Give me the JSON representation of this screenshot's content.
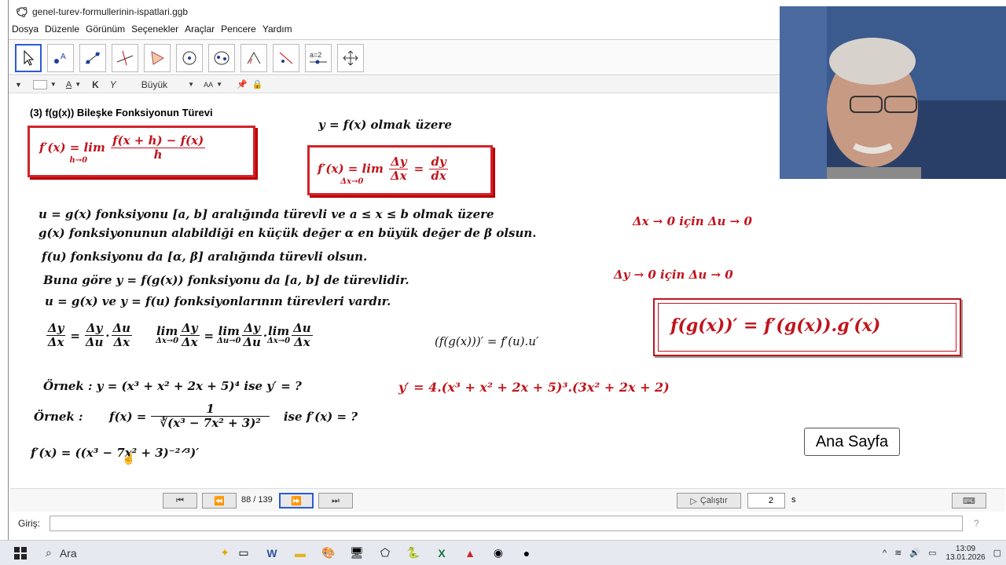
{
  "window": {
    "title": "genel-turev-formullerinin-ispatlari.ggb"
  },
  "menu": [
    "Dosya",
    "Düzenle",
    "Görünüm",
    "Seçenekler",
    "Araçlar",
    "Pencere",
    "Yardım"
  ],
  "stylebar": {
    "bold": "K",
    "italic": "Y",
    "size": "Büyük",
    "aa": "AA"
  },
  "slide": {
    "heading": "(3) f(g(x)) Bileşke Fonksiyonun Türevi",
    "def1": {
      "lhs": "f′(x) = lim",
      "sub": "h→0",
      "num": "f(x + h) − f(x)",
      "den": "h"
    },
    "intro": "y = f(x) olmak üzere",
    "def2": {
      "lhs": "f′(x) = lim",
      "sub": "Δx→0",
      "num": "Δy",
      "den": "Δx",
      "eq": "=",
      "num2": "dy",
      "den2": "dx"
    },
    "l1": "u = g(x) fonksiyonu [a, b] aralığında türevli ve a ≤ x ≤ b olmak üzere",
    "l2": "g(x) fonksiyonunun alabildiği en küçük değer α en büyük değer de β olsun.",
    "l3": "f(u) fonksiyonu da [α, β] aralığında türevli olsun.",
    "l4": "Buna göre y = f(g(x)) fonksiyonu da [a, b] de türevlidir.",
    "l5": "u = g(x) ve y = f(u) fonksiyonlarının türevleri vardır.",
    "r1": "Δx → 0 için Δu → 0",
    "r2": "Δy → 0 için Δu → 0",
    "chain": {
      "dy": "Δy",
      "dx": "Δx",
      "du": "Δu",
      "eq": "=",
      "dot": "·",
      "lim": "lim",
      "s1": "Δx→0",
      "s2": "Δu→0"
    },
    "prime": "(f(g(x)))′ = f′(u).u′",
    "rule": "f(g(x))′ = f′(g(x)).g′(x)",
    "ex1": "Örnek :  y = (x³ + x² + 2x + 5)⁴  ise  y′ = ?",
    "ans1": "y′ = 4.(x³ + x² + 2x + 5)³.(3x² + 2x + 2)",
    "ex2lbl": "Örnek :",
    "ex2lhs": "f(x) =",
    "ex2num": "1",
    "ex2den": "∛(x³ − 7x² + 3)²",
    "ex2q": "ise f′(x) = ?",
    "work": "f′(x) = ((x³ − 7x² + 3)⁻²ᐟ³)′",
    "home": "Ana Sayfa"
  },
  "nav": {
    "page": "88 / 139",
    "play": "Çalıştır",
    "step": "2",
    "unit": "s"
  },
  "input": {
    "label": "Giriş:"
  },
  "taskbar": {
    "search": "Ara",
    "time": "13:09",
    "date": "13.01.2026"
  }
}
